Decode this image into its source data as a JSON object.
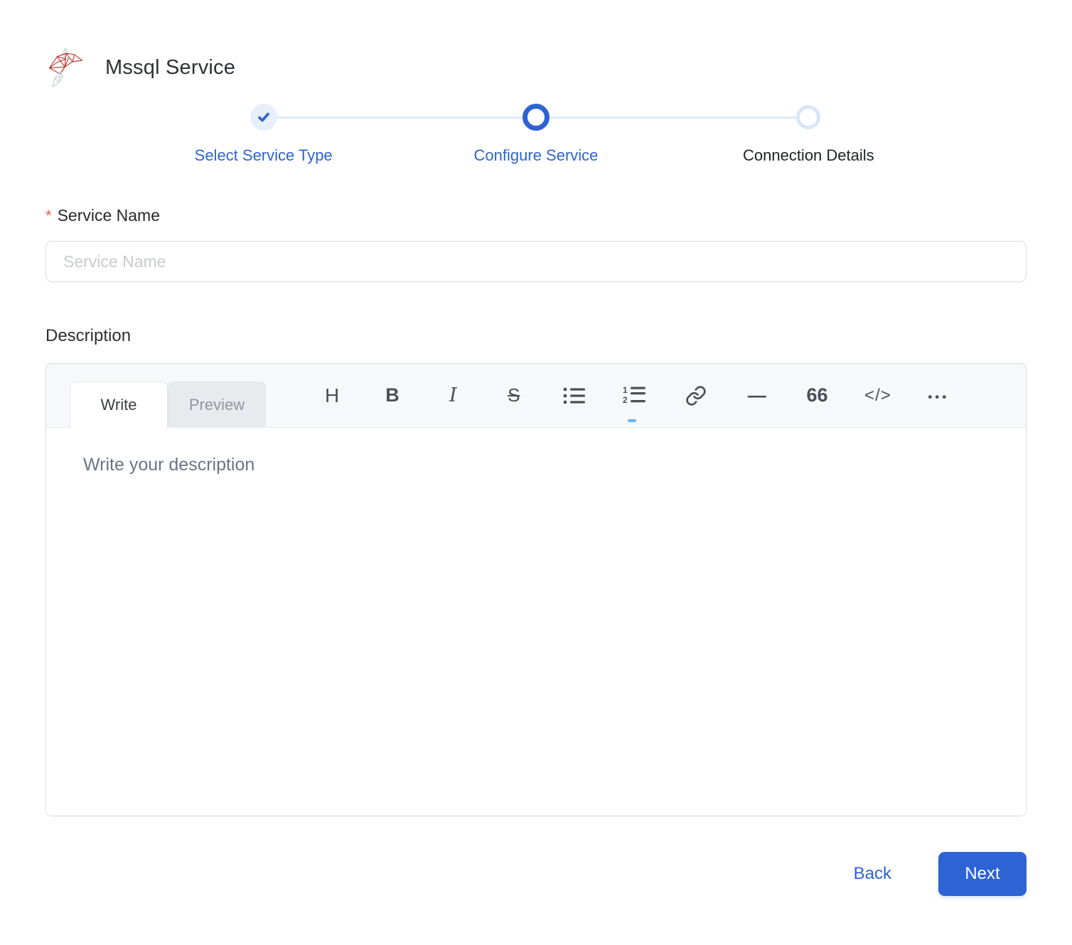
{
  "header": {
    "title": "Mssql Service",
    "logo": "sql-server-logo"
  },
  "stepper": {
    "steps": [
      {
        "label": "Select Service Type",
        "state": "completed"
      },
      {
        "label": "Configure Service",
        "state": "active"
      },
      {
        "label": "Connection Details",
        "state": "upcoming"
      }
    ]
  },
  "form": {
    "service_name": {
      "label": "Service Name",
      "required_marker": "*",
      "placeholder": "Service Name",
      "value": ""
    },
    "description": {
      "label": "Description",
      "placeholder": "Write your description",
      "value": ""
    }
  },
  "editor": {
    "tabs": [
      {
        "label": "Write",
        "active": true
      },
      {
        "label": "Preview",
        "active": false
      }
    ],
    "toolbar": [
      {
        "name": "heading",
        "glyph": "H"
      },
      {
        "name": "bold",
        "glyph": "B"
      },
      {
        "name": "italic",
        "glyph": "I"
      },
      {
        "name": "strikethrough",
        "glyph": "S"
      },
      {
        "name": "unordered-list",
        "glyph": ""
      },
      {
        "name": "ordered-list",
        "glyph": ""
      },
      {
        "name": "link",
        "glyph": ""
      },
      {
        "name": "horizontal-rule",
        "glyph": "—"
      },
      {
        "name": "quote",
        "glyph": "66"
      },
      {
        "name": "code",
        "glyph": "</>"
      },
      {
        "name": "more",
        "glyph": "•••"
      }
    ]
  },
  "footer": {
    "back_label": "Back",
    "next_label": "Next"
  },
  "colors": {
    "accent_blue": "#2d63d3",
    "step_done_bg": "#e7effb",
    "track_line": "#dde9f8",
    "upcoming_ring": "#d9e6f8",
    "required_red": "#ee5b55",
    "toolbar_bg": "#f7f8fa",
    "border_gray": "#d8dbe2",
    "logo_red": "#b2322c",
    "logo_gray": "#c3cad1"
  }
}
